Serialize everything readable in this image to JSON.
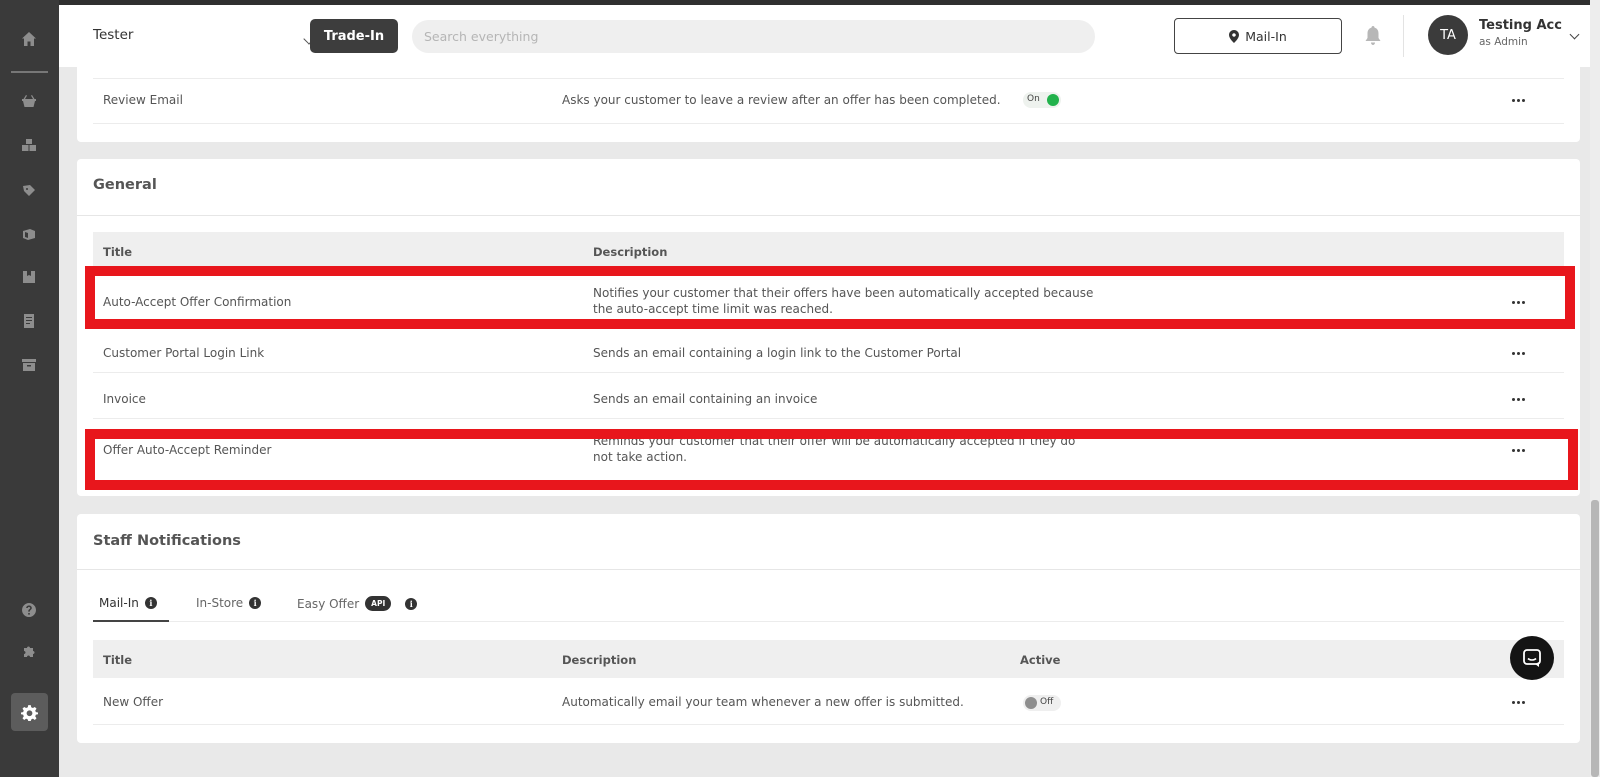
{
  "header": {
    "store_name": "Tester",
    "tradein_label": "Trade-In",
    "search_placeholder": "Search everything",
    "location_label": "Mail-In",
    "user_initials": "TA",
    "user_name": "Testing Acc",
    "user_role": "as Admin"
  },
  "top_card": {
    "row": {
      "title": "Review Email",
      "description": "Asks your customer to leave a review after an offer has been completed.",
      "toggle_label": "On",
      "toggle_state": "on"
    }
  },
  "general": {
    "title": "General",
    "columns": {
      "title": "Title",
      "description": "Description"
    },
    "rows": [
      {
        "title": "Auto-Accept Offer Confirmation",
        "description_line1": "Notifies your customer that their offers have been automatically accepted because",
        "description_line2": "the auto-accept time limit was reached."
      },
      {
        "title": "Customer Portal Login Link",
        "description_line1": "Sends an email containing a login link to the Customer Portal",
        "description_line2": ""
      },
      {
        "title": "Invoice",
        "description_line1": "Sends an email containing an invoice",
        "description_line2": ""
      },
      {
        "title": "Offer Auto-Accept Reminder",
        "description_line1": "Reminds your customer that their offer will be automatically accepted if they do",
        "description_line2": "not take action."
      }
    ]
  },
  "staff": {
    "title": "Staff Notifications",
    "tabs": [
      {
        "label": "Mail-In",
        "active": true
      },
      {
        "label": "In-Store",
        "active": false
      },
      {
        "label": "Easy Offer",
        "badge": "API",
        "active": false
      }
    ],
    "columns": {
      "title": "Title",
      "description": "Description",
      "active": "Active"
    },
    "rows": [
      {
        "title": "New Offer",
        "description": "Automatically email your team whenever a new offer is submitted.",
        "toggle_label": "Off",
        "toggle_state": "off"
      }
    ]
  },
  "colors": {
    "highlight": "#e8161c",
    "toggle_on": "#22b24c",
    "toggle_off": "#8e8e8e",
    "sidebar": "#3a3a3a"
  },
  "icons": {
    "sidebar": [
      "home-icon",
      "basket-icon",
      "boxes-icon",
      "tag-icon",
      "packages-icon",
      "box-icon",
      "receipt-icon",
      "archive-icon",
      "help-icon",
      "puzzle-icon",
      "gear-icon"
    ],
    "header": [
      "chevron-down-icon",
      "location-pin-icon",
      "bell-icon"
    ],
    "misc": [
      "more-dots-icon",
      "info-icon",
      "chat-icon"
    ]
  }
}
